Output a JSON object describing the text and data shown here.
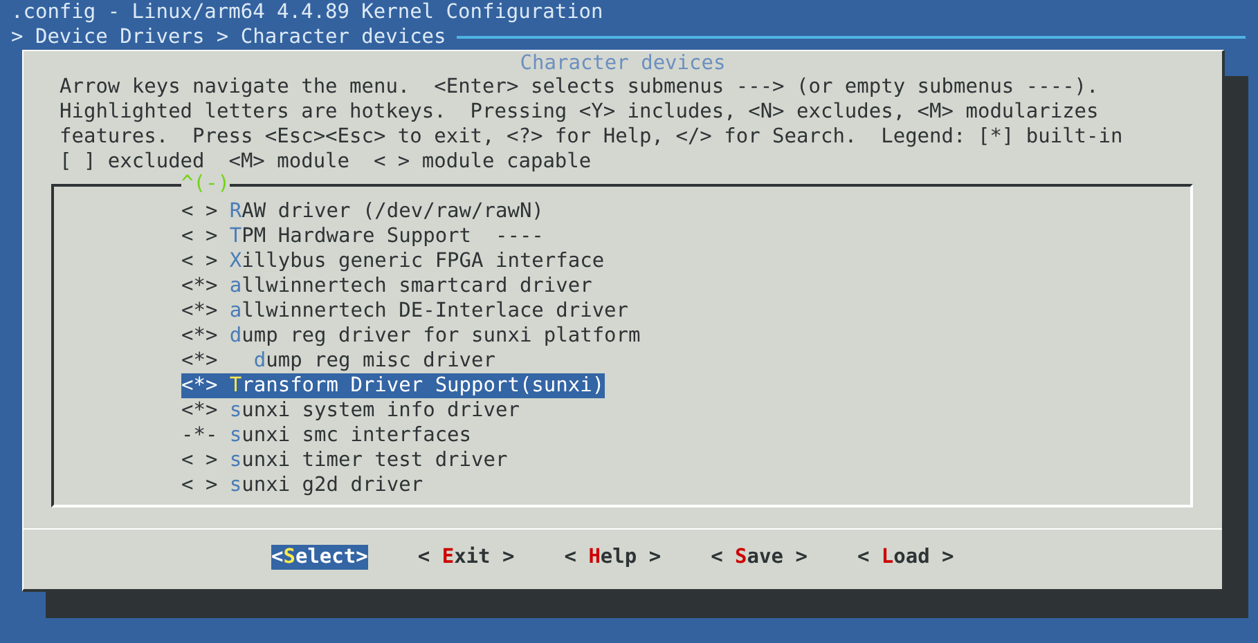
{
  "window": {
    "title": ".config - Linux/arm64 4.4.89 Kernel Configuration"
  },
  "breadcrumb": "> Device Drivers > Character devices",
  "dialog": {
    "title": "Character devices",
    "help_text": [
      "Arrow keys navigate the menu.  <Enter> selects submenus ---> (or empty submenus ----).",
      "Highlighted letters are hotkeys.  Pressing <Y> includes, <N> excludes, <M> modularizes",
      "features.  Press <Esc><Esc> to exit, <?> for Help, </> for Search.  Legend: [*] built-in",
      "[ ] excluded  <M> module  < > module capable"
    ],
    "scroll_indicator": "^(-)",
    "items": [
      {
        "state": "< >",
        "label": "RAW driver (/dev/raw/rawN)",
        "selected": false
      },
      {
        "state": "< >",
        "label": "TPM Hardware Support  ----",
        "selected": false
      },
      {
        "state": "< >",
        "label": "Xillybus generic FPGA interface",
        "selected": false
      },
      {
        "state": "<*>",
        "label": "allwinnertech smartcard driver",
        "selected": false
      },
      {
        "state": "<*>",
        "label": "allwinnertech DE-Interlace driver",
        "selected": false
      },
      {
        "state": "<*>",
        "label": "dump reg driver for sunxi platform",
        "selected": false,
        "children": [
          {
            "state": "<*>",
            "label": "dump reg misc driver",
            "selected": false
          }
        ]
      },
      {
        "state": "<*>",
        "label": "Transform Driver Support(sunxi)",
        "selected": true
      },
      {
        "state": "<*>",
        "label": "sunxi system info driver",
        "selected": false
      },
      {
        "state": "-*-",
        "label": "sunxi smc interfaces",
        "selected": false
      },
      {
        "state": "< >",
        "label": "sunxi timer test driver",
        "selected": false
      },
      {
        "state": "< >",
        "label": "sunxi g2d driver",
        "selected": false
      }
    ],
    "buttons": [
      {
        "text": "<Select>",
        "selected": true
      },
      {
        "text": "< Exit >",
        "selected": false
      },
      {
        "text": "< Help >",
        "selected": false
      },
      {
        "text": "< Save >",
        "selected": false
      },
      {
        "text": "< Load >",
        "selected": false
      }
    ]
  }
}
